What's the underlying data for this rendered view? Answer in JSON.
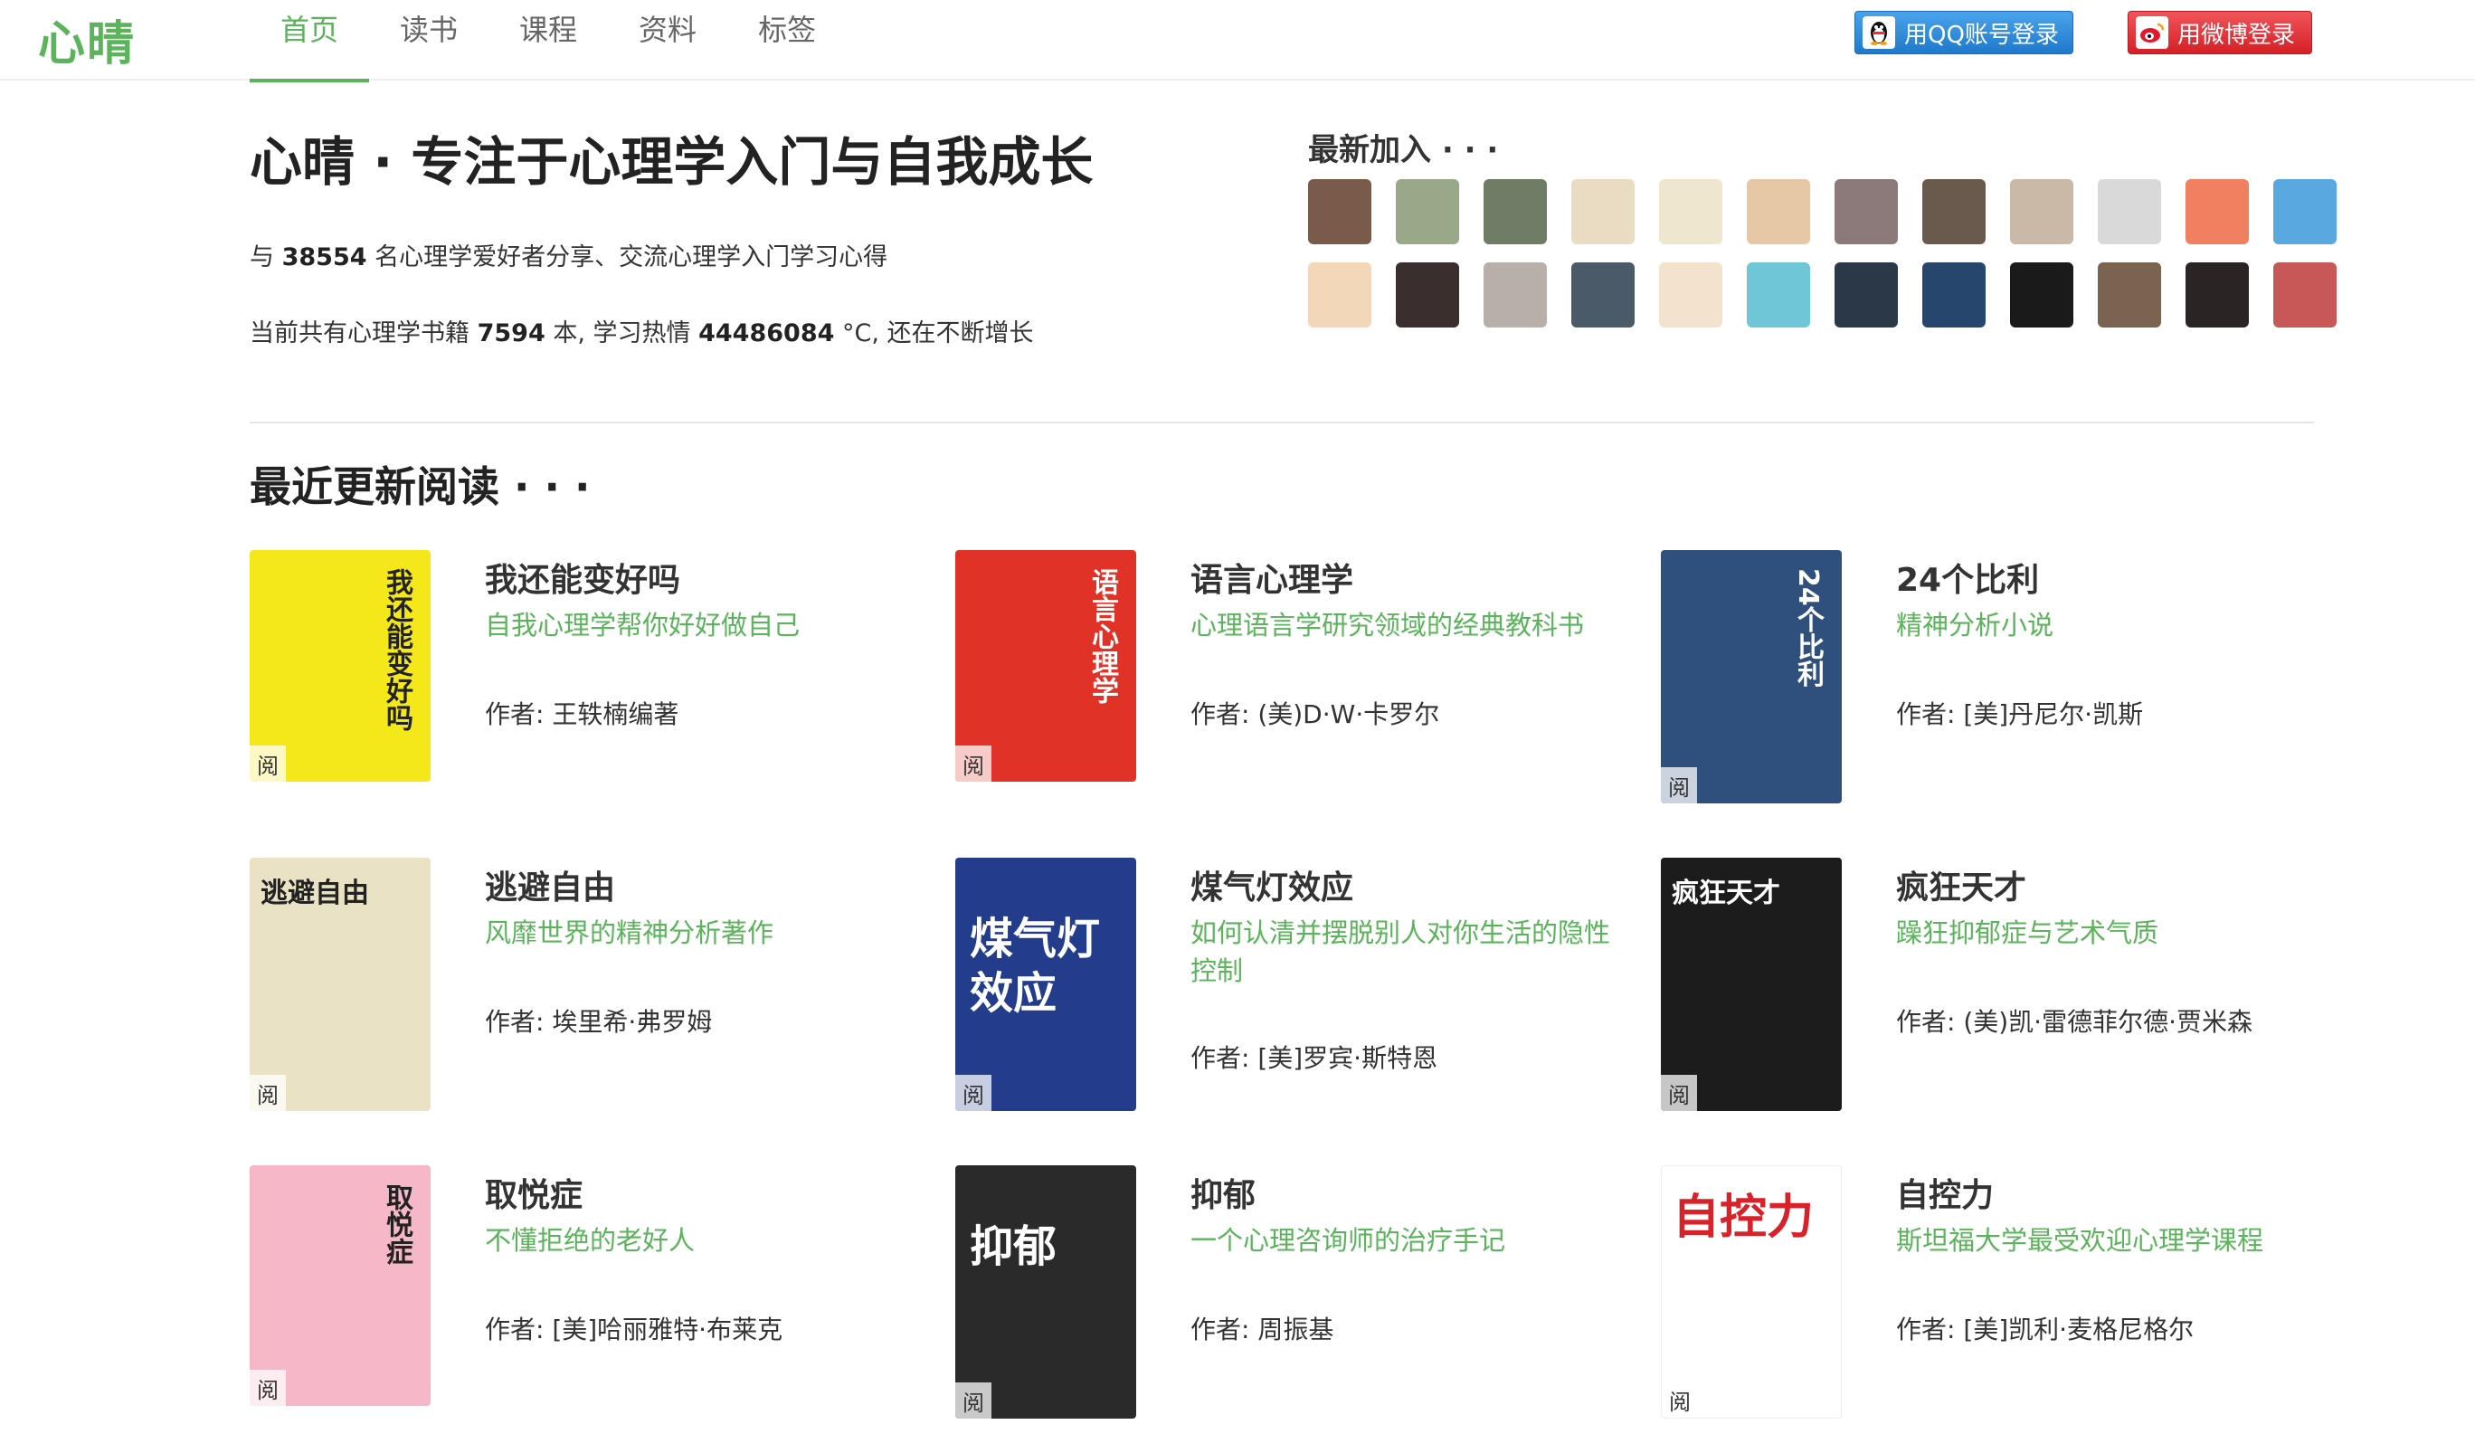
{
  "header": {
    "logo": "心晴",
    "nav": [
      "首页",
      "读书",
      "课程",
      "资料",
      "标签"
    ],
    "qq_login": "用QQ账号登录",
    "weibo_login": "用微博登录"
  },
  "intro": {
    "title": "心晴 · 专注于心理学入门与自我成长",
    "line1_prefix": "与",
    "line1_count": "38554",
    "line1_suffix": "名心理学爱好者分享、交流心理学入门学习心得",
    "line2_prefix": "当前共有心理学书籍",
    "line2_books": "7594",
    "line2_mid": "本, 学习热情",
    "line2_heat": "44486084",
    "line2_suffix": "°C, 还在不断增长"
  },
  "latest": {
    "title": "最新加入 · · ·",
    "avatar_colors": [
      "#7a5a48",
      "#9aa88a",
      "#6f7c66",
      "#e9dcc3",
      "#efe6cf",
      "#e6c8a6",
      "#8c7a7a",
      "#6a5a4e",
      "#c9b9a6",
      "#d9d9d9",
      "#f08060",
      "#5aa8e0",
      "#f2d8b8",
      "#3a2e2e",
      "#b8b0a8",
      "#4a5a68",
      "#f3e3cc",
      "#6ec6d6",
      "#2a3848",
      "#26466e",
      "#1a1a1a",
      "#7a6450",
      "#2a2424",
      "#c85858"
    ]
  },
  "recent": {
    "title": "最近更新阅读 · · ·",
    "read_badge": "阅",
    "books": [
      {
        "title": "我还能变好吗",
        "subtitle": "自我心理学帮你好好做自己",
        "author": "作者: 王轶楠编著",
        "cover_color": "#f5e81a",
        "cover_text": "我还能变好吗"
      },
      {
        "title": "语言心理学",
        "subtitle": "心理语言学研究领域的经典教科书",
        "author": "作者: (美)D·W·卡罗尔",
        "cover_color": "#e03226",
        "cover_text": "语言心理学"
      },
      {
        "title": "24个比利",
        "subtitle": "精神分析小说",
        "author": "作者: [美]丹尼尔·凯斯",
        "cover_color": "#2f4f7c",
        "cover_text": "24个比利"
      },
      {
        "title": "逃避自由",
        "subtitle": "风靡世界的精神分析著作",
        "author": "作者: 埃里希·弗罗姆",
        "cover_color": "#e9e2c4",
        "cover_text": "逃避自由"
      },
      {
        "title": "煤气灯效应",
        "subtitle": "如何认清并摆脱别人对你生活的隐性控制",
        "author": "作者: [美]罗宾·斯特恩",
        "cover_color": "#233c8c",
        "cover_text": "煤气灯效应"
      },
      {
        "title": "疯狂天才",
        "subtitle": "躁狂抑郁症与艺术气质",
        "author": "作者: (美)凯·雷德菲尔德·贾米森",
        "cover_color": "#1c1c1c",
        "cover_text": "疯狂天才"
      },
      {
        "title": "取悦症",
        "subtitle": "不懂拒绝的老好人",
        "author": "作者: [美]哈丽雅特·布莱克",
        "cover_color": "#f6b8c8",
        "cover_text": "取悦症"
      },
      {
        "title": "抑郁",
        "subtitle": "一个心理咨询师的治疗手记",
        "author": "作者: 周振基",
        "cover_color": "#2a2a2a",
        "cover_text": "抑郁"
      },
      {
        "title": "自控力",
        "subtitle": "斯坦福大学最受欢迎心理学课程",
        "author": "作者: [美]凯利·麦格尼格尔",
        "cover_color": "#ffffff",
        "cover_text": "自控力"
      }
    ]
  }
}
